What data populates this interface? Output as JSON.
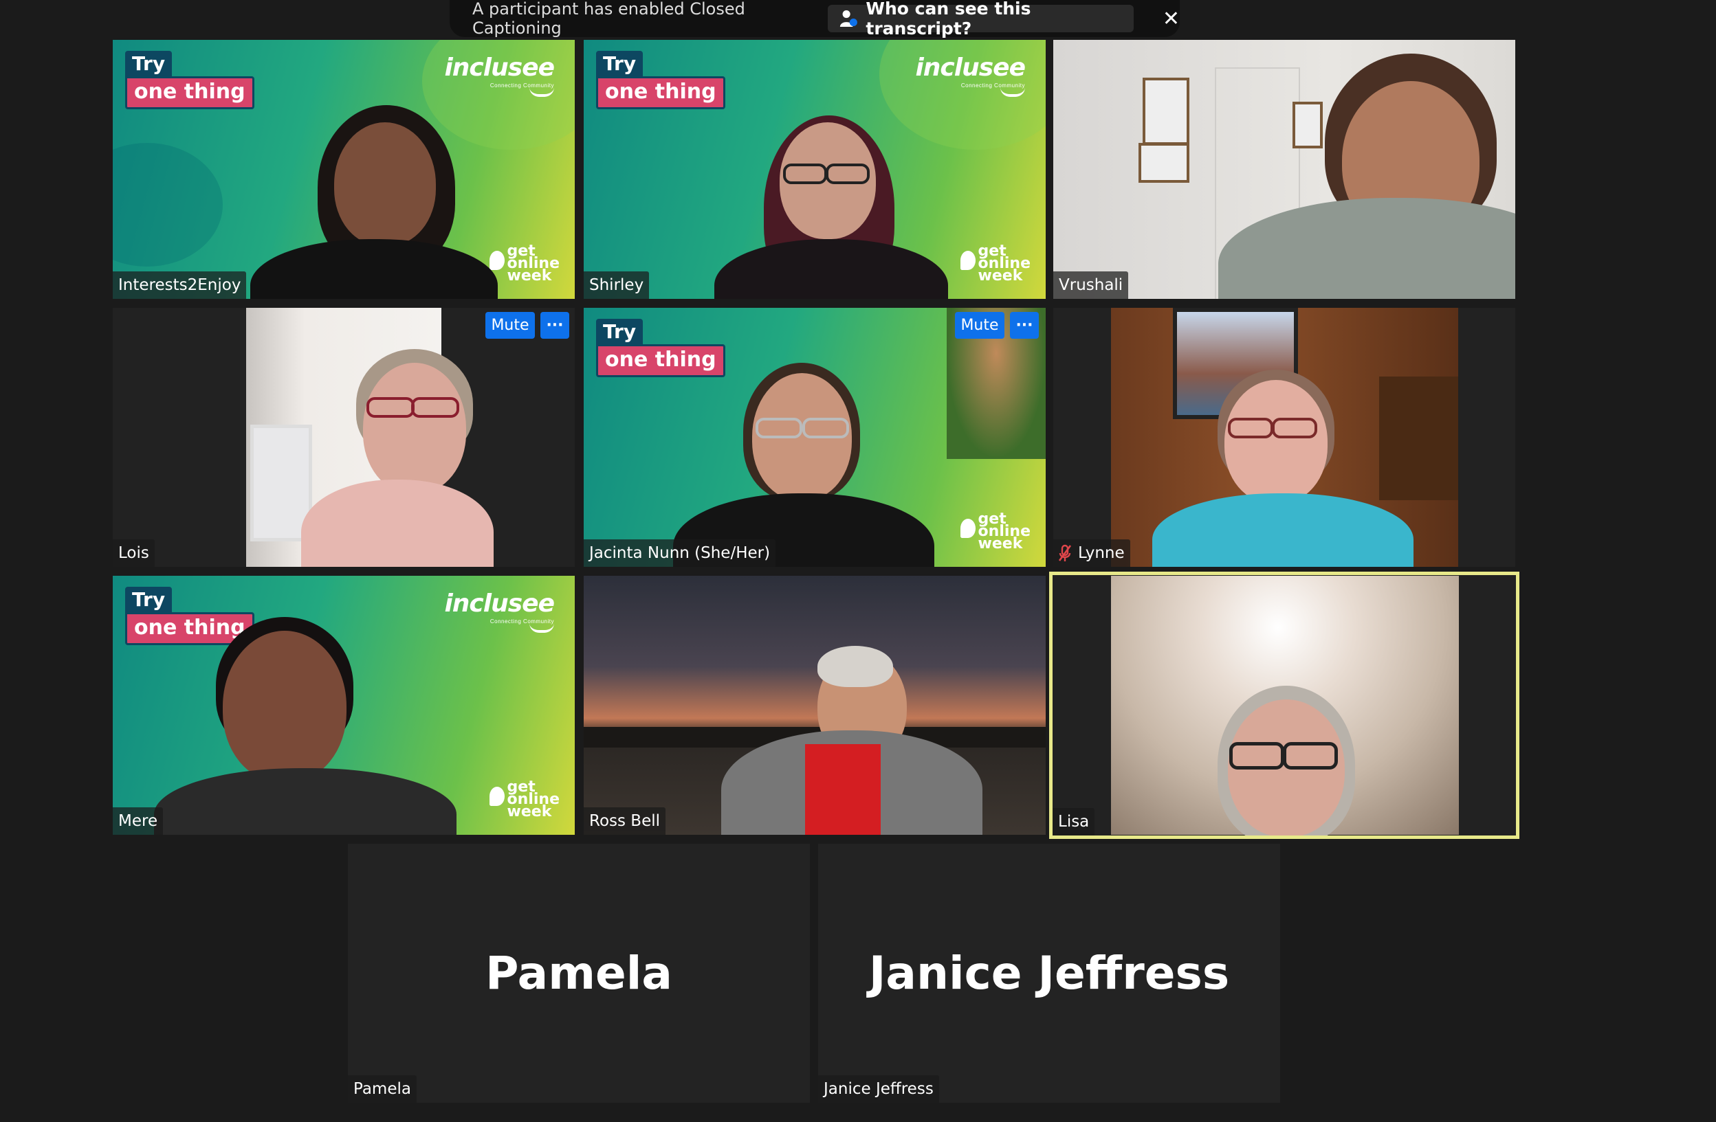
{
  "caption_banner": {
    "message": "A participant has enabled Closed Captioning",
    "who_button": "Who can see this transcript?",
    "close_symbol": "✕"
  },
  "tile_buttons": {
    "mute": "Mute",
    "more": "···"
  },
  "banner": {
    "try": "Try",
    "one_thing": "one thing",
    "brand": "inclusee",
    "brand_tagline": "Connecting Community",
    "gow_line1": "get",
    "gow_line2": "online",
    "gow_line3": "week"
  },
  "participants": [
    {
      "name": "Interests2Enjoy"
    },
    {
      "name": "Shirley"
    },
    {
      "name": "Vrushali"
    },
    {
      "name": "Lois"
    },
    {
      "name": "Jacinta Nunn (She/Her)"
    },
    {
      "name": "Lynne",
      "muted": true
    },
    {
      "name": "Mere"
    },
    {
      "name": "Ross Bell"
    },
    {
      "name": "Lisa",
      "speaking": true
    },
    {
      "name": "Pamela",
      "video_off": true
    },
    {
      "name": "Janice Jeffress",
      "video_off": true
    }
  ],
  "colors": {
    "accent_blue": "#0e71eb",
    "speaker_border": "#e8e98a",
    "tile_bg": "#222222"
  }
}
